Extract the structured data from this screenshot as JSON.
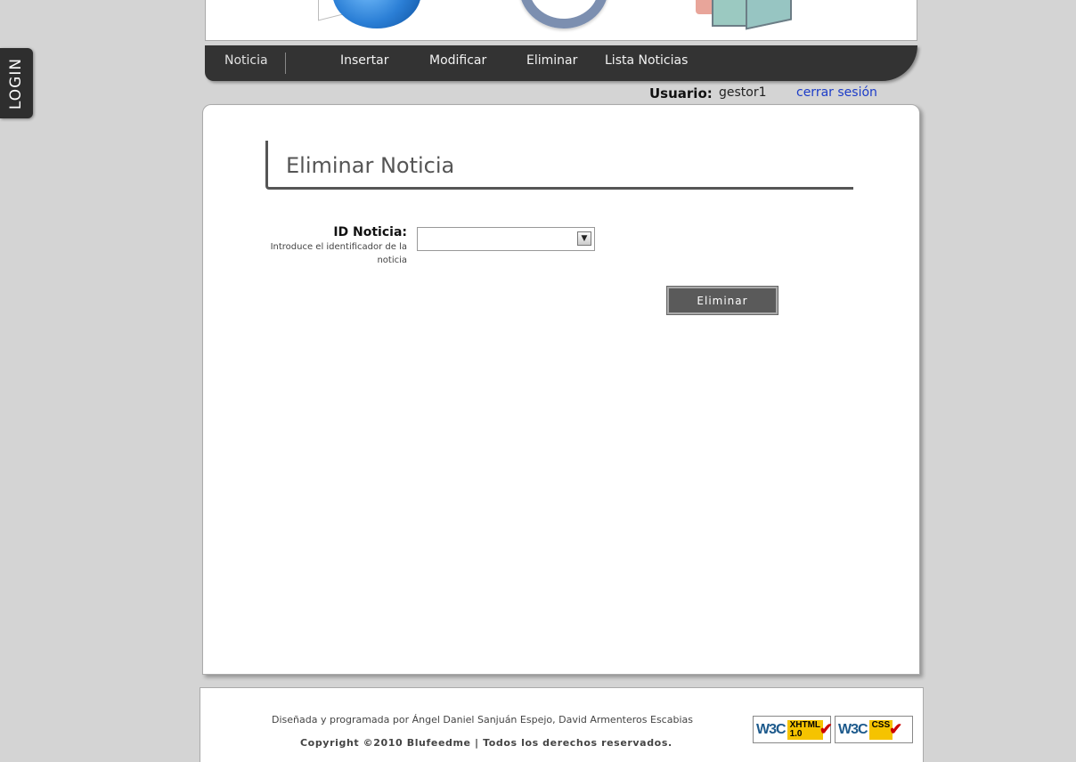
{
  "login_tab": {
    "label": "LOGIN"
  },
  "nav": {
    "section": "Noticia",
    "items": [
      "Insertar",
      "Modificar",
      "Eliminar",
      "Lista Noticias"
    ]
  },
  "user": {
    "label": "Usuario:",
    "name": "gestor1",
    "logout": "cerrar sesión"
  },
  "page": {
    "title": "Eliminar Noticia",
    "field_label": "ID Noticia:",
    "field_hint": "Introduce el identificador de la noticia",
    "select_value": "",
    "submit_label": "Eliminar"
  },
  "footer": {
    "credits": "Diseñada y programada por Ángel Daniel Sanjuán Espejo, David Armenteros Escabias",
    "copyright": "Copyright ©2010 Blufeedme | Todos los derechos reservados.",
    "badge_w3c": "W3C",
    "badge_xhtml": "XHTML 1.0",
    "badge_css": "CSS"
  }
}
